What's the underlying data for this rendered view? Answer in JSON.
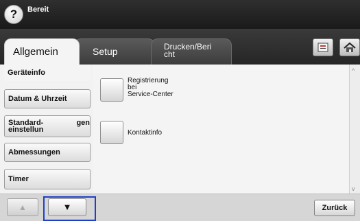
{
  "status": {
    "help_icon": "?",
    "text": "Bereit"
  },
  "tabs": [
    {
      "label": "Allgemein",
      "active": true
    },
    {
      "label": "Setup",
      "active": false
    },
    {
      "label_line1": "Drucken/Beri",
      "label_line2": "cht",
      "active": false
    }
  ],
  "toolbar": {
    "job_icon": "job-status-icon",
    "home_icon": "home-icon"
  },
  "sidebar": {
    "items": [
      {
        "label": "Geräteinfo",
        "selected": true
      },
      {
        "label": "Datum & Uhrzeit",
        "selected": false
      },
      {
        "label_line1": "Standard-einstellun",
        "label_line2": "gen",
        "selected": false
      },
      {
        "label": "Abmessungen",
        "selected": false
      },
      {
        "label": "Timer",
        "selected": false
      }
    ]
  },
  "main": {
    "options": [
      {
        "line1": "Registrierung",
        "line2": "bei",
        "line3": "Service-Center"
      },
      {
        "label": "Kontaktinfo"
      }
    ]
  },
  "scroll": {
    "up_arrow": "^",
    "down_arrow": "v"
  },
  "bottom": {
    "up_arrow": "▲",
    "down_arrow": "▼",
    "back_label": "Zurück"
  },
  "colors": {
    "topbar": "#1f1f1f",
    "highlight": "#1e3fc6",
    "panel": "#f4f4f4"
  }
}
